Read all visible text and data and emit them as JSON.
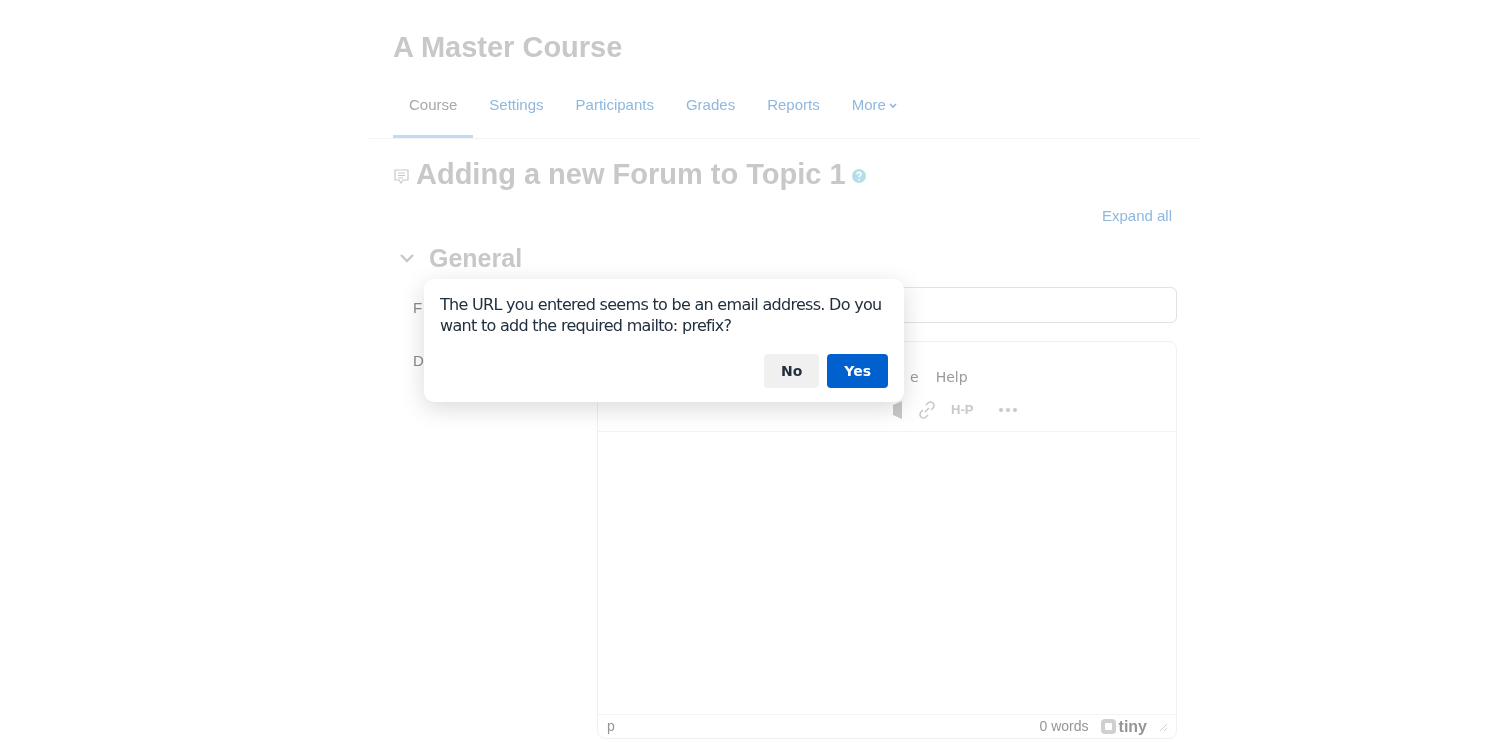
{
  "course_title": "A Master Course",
  "tabs": [
    {
      "label": "Course",
      "selected": true
    },
    {
      "label": "Settings",
      "selected": false
    },
    {
      "label": "Participants",
      "selected": false
    },
    {
      "label": "Grades",
      "selected": false
    },
    {
      "label": "Reports",
      "selected": false
    },
    {
      "label": "More",
      "selected": false
    }
  ],
  "page_heading": "Adding a new Forum to Topic 1",
  "expand_all": "Expand all",
  "section": {
    "title": "General",
    "expanded": true
  },
  "form": {
    "name_label": "F",
    "description_label": "D"
  },
  "editor": {
    "menubar": [
      "e",
      "Help"
    ],
    "toolbar_text": "H-P",
    "status_path": "p",
    "word_count": "0 words",
    "brand": "tiny"
  },
  "dialog": {
    "message": "The URL you entered seems to be an email address. Do you want to add the required mailto: prefix?",
    "buttons": [
      {
        "label": "No",
        "kind": "secondary"
      },
      {
        "label": "Yes",
        "kind": "primary"
      }
    ]
  }
}
